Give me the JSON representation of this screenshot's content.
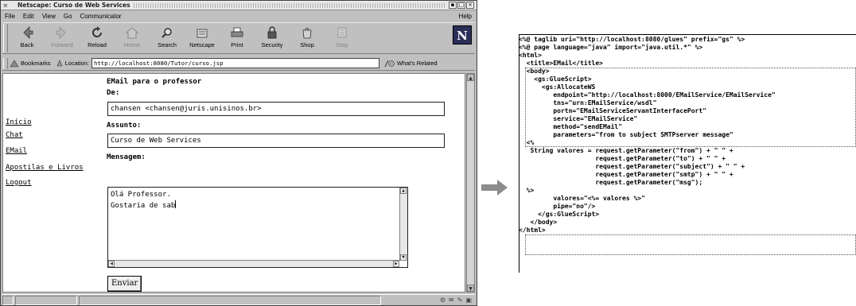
{
  "window": {
    "title": "Netscape: Curso de Web Services",
    "buttons": [
      "▪",
      "□",
      "×"
    ]
  },
  "menu": {
    "items": [
      "File",
      "Edit",
      "View",
      "Go",
      "Communicator"
    ],
    "help": "Help"
  },
  "toolbar": {
    "buttons": [
      {
        "label": "Back",
        "icon": "back-arrow-icon"
      },
      {
        "label": "Forward",
        "icon": "forward-arrow-icon"
      },
      {
        "label": "Reload",
        "icon": "reload-icon"
      },
      {
        "label": "Home",
        "icon": "home-icon"
      },
      {
        "label": "Search",
        "icon": "search-icon"
      },
      {
        "label": "Netscape",
        "icon": "netscape-icon"
      },
      {
        "label": "Print",
        "icon": "print-icon"
      },
      {
        "label": "Security",
        "icon": "lock-icon"
      },
      {
        "label": "Shop",
        "icon": "shop-icon"
      },
      {
        "label": "Stop",
        "icon": "stop-icon"
      }
    ],
    "logo": "N"
  },
  "location": {
    "bookmarks_label": "Bookmarks",
    "location_label": "Location:",
    "url": "http://localhost:8080/Tutor/curso.jsp",
    "whats_related": "What's Related"
  },
  "page": {
    "nav": [
      "Início",
      "Chat",
      "EMail",
      "Apostilas e Livros",
      "Logout"
    ],
    "heading": "EMail para o professor",
    "from_label": "De:",
    "from_value": "chansen <chansen@juris.unisinos.br>",
    "subject_label": "Assunto:",
    "subject_value": "Curso de Web Services",
    "message_label": "Mensagem:",
    "message_line1": "Olá Professor.",
    "message_line2": "Gostaria de sab",
    "send_button": "Enviar"
  },
  "code": {
    "lines": [
      "<%@ taglib uri=\"http://localhost:8080/glues\" prefix=\"gs\" %>",
      "<%@ page language=\"java\" import=\"java.util.*\" %>",
      "<html>",
      "  <title>EMail</title>",
      "  <body>",
      "    <gs:GlueScript>",
      "      <gs:AllocateWS",
      "         endpoint=\"http://localhost:8000/EMailService/EMailService\"",
      "         tns=\"urn:EMailService/wsdl\"",
      "         portn=\"EMailServiceServantInterfacePort\"",
      "         service=\"EMailService\"",
      "         method=\"sendEMail\"",
      "         parameters=\"from to subject SMTPserver message\"",
      "  <%",
      "   String valores = request.getParameter(\"from\") + \" \" +",
      "                    request.getParameter(\"to\") + \" \" +",
      "                    request.getParameter(\"subject\") + \" \" +",
      "                    request.getParameter(\"smtp\") + \" \" +",
      "                    request.getParameter(\"msg\");",
      "  %>",
      "         valores=\"<%= valores %>\"",
      "         pipe=\"no\"/>",
      "     </gs:GlueScript>",
      "   </body>",
      "</html>"
    ]
  }
}
